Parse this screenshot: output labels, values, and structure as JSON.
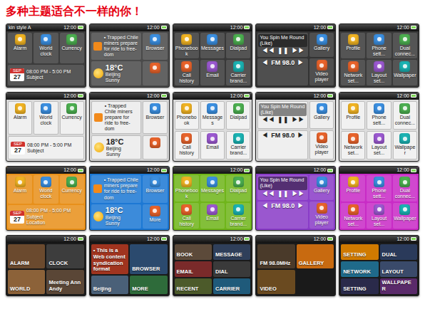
{
  "title": "多种主题适合不一样的你！",
  "rows": [
    {
      "screens": [
        {
          "kind": "home",
          "color": "#3c3c3c",
          "time": "12:00",
          "caption": "kin style A",
          "tiles": [
            {
              "kind": "app",
              "label": "Alarm"
            },
            {
              "kind": "app",
              "label": "World clock"
            },
            {
              "kind": "app",
              "label": "Currency"
            },
            {
              "kind": "event",
              "month": "SEP",
              "day": "27",
              "when": "08:00 PM - 5:00 PM",
              "subject": "Subject"
            }
          ]
        },
        {
          "kind": "feeds",
          "color": "#4a4a4a",
          "time": "12:00",
          "tiles": [
            {
              "kind": "news",
              "text": "• Trapped Chile miners prepare for ride to free-dom"
            },
            {
              "kind": "app",
              "label": "Browser"
            },
            {
              "kind": "weather",
              "temp": "18°C",
              "city": "Beijing",
              "sky": "Sunny"
            },
            {
              "kind": "app"
            }
          ]
        },
        {
          "kind": "comm",
          "color": "#383838",
          "time": "12:00",
          "tiles": [
            {
              "kind": "app",
              "label": "Phonebook"
            },
            {
              "kind": "app",
              "label": "Messages"
            },
            {
              "kind": "app",
              "label": "Dialpad"
            },
            {
              "kind": "app",
              "label": "Call history"
            },
            {
              "kind": "app",
              "label": "Email"
            },
            {
              "kind": "app",
              "label": "Carrier brand..."
            }
          ]
        },
        {
          "kind": "music",
          "color": "#333333",
          "time": "12:00",
          "tiles": [
            {
              "kind": "player",
              "song": "You Spin Me Round (Like)",
              "controls": [
                "◀◀",
                "❚❚",
                "▶▶"
              ]
            },
            {
              "kind": "app",
              "label": "Gallery"
            },
            {
              "kind": "radio",
              "station": "FM 98.0",
              "controls": [
                "◀",
                "▶"
              ]
            },
            {
              "kind": "app",
              "label": "Video player"
            }
          ]
        },
        {
          "kind": "settings",
          "color": "#3a3a3a",
          "time": "12:00",
          "tiles": [
            {
              "kind": "app",
              "label": "Profile"
            },
            {
              "kind": "app",
              "label": "Phone sett..."
            },
            {
              "kind": "app",
              "label": "Dual connec..."
            },
            {
              "kind": "app",
              "label": "Network set..."
            },
            {
              "kind": "app",
              "label": "Layout set..."
            },
            {
              "kind": "app",
              "label": "Wallpaper"
            }
          ]
        }
      ]
    },
    {
      "screens": [
        {
          "kind": "home",
          "color": "#dadada",
          "time": "12:00",
          "tiles": [
            {
              "kind": "app",
              "label": "Alarm"
            },
            {
              "kind": "app",
              "label": "World clock"
            },
            {
              "kind": "app",
              "label": "Currency"
            },
            {
              "kind": "event",
              "month": "SEP",
              "day": "27",
              "when": "08:00 PM - 5:00 PM",
              "subject": "Subject"
            }
          ]
        },
        {
          "kind": "feeds",
          "color": "#d4d4d4",
          "time": "12:00",
          "tiles": [
            {
              "kind": "news",
              "text": "• Trapped Chile miners prepare for ride to free-dom"
            },
            {
              "kind": "app",
              "label": "Browser"
            },
            {
              "kind": "weather",
              "temp": "18°C",
              "city": "Beijing",
              "sky": "Sunny"
            },
            {
              "kind": "app"
            }
          ]
        },
        {
          "kind": "comm",
          "color": "#dcdcdc",
          "time": "12:00",
          "tiles": [
            {
              "kind": "app",
              "label": "Phonebook"
            },
            {
              "kind": "app",
              "label": "Messages"
            },
            {
              "kind": "app",
              "label": "Dialpad"
            },
            {
              "kind": "app",
              "label": "Call history"
            },
            {
              "kind": "app",
              "label": "Email"
            },
            {
              "kind": "app",
              "label": "Carrier brand..."
            }
          ]
        },
        {
          "kind": "music",
          "color": "#d6d6d6",
          "time": "12:00",
          "tiles": [
            {
              "kind": "player",
              "song": "You Spin Me Round (Like)",
              "controls": [
                "◀◀",
                "❚❚",
                "▶▶"
              ]
            },
            {
              "kind": "app",
              "label": "Gallery"
            },
            {
              "kind": "radio",
              "station": "FM 98.0",
              "controls": [
                "◀",
                "▶"
              ]
            },
            {
              "kind": "app",
              "label": "Video player"
            }
          ]
        },
        {
          "kind": "settings",
          "color": "#dddddd",
          "time": "12:00",
          "tiles": [
            {
              "kind": "app",
              "label": "Profile"
            },
            {
              "kind": "app",
              "label": "Phone sett..."
            },
            {
              "kind": "app",
              "label": "Dual connec..."
            },
            {
              "kind": "app",
              "label": "Network set..."
            },
            {
              "kind": "app",
              "label": "Layout set..."
            },
            {
              "kind": "app",
              "label": "Wallpaper"
            }
          ]
        }
      ]
    },
    {
      "screens": [
        {
          "kind": "home",
          "color": "#e8901a",
          "time": "12:00",
          "tiles": [
            {
              "kind": "app",
              "label": "Alarm"
            },
            {
              "kind": "app",
              "label": "World clock"
            },
            {
              "kind": "app",
              "label": "Currency"
            },
            {
              "kind": "event",
              "month": "SEP",
              "day": "27",
              "when": "08:00 PM - 5:00 PM",
              "subject": "Subject",
              "place": "Location"
            }
          ]
        },
        {
          "kind": "feeds",
          "color": "#1c78d4",
          "time": "12:00",
          "tiles": [
            {
              "kind": "news",
              "text": "• Trapped Chile miners prepare for ride to free-dom"
            },
            {
              "kind": "app",
              "label": "Browser"
            },
            {
              "kind": "weather",
              "temp": "18°C",
              "city": "Beijing",
              "sky": "Sunny"
            },
            {
              "kind": "app",
              "label": "More"
            }
          ]
        },
        {
          "kind": "comm",
          "color": "#6fb51a",
          "time": "12:00",
          "tiles": [
            {
              "kind": "app",
              "label": "Phonebook"
            },
            {
              "kind": "app",
              "label": "Messages"
            },
            {
              "kind": "app",
              "label": "Dialpad"
            },
            {
              "kind": "app",
              "label": "Call history"
            },
            {
              "kind": "app",
              "label": "Email"
            },
            {
              "kind": "app",
              "label": "Carrier brand..."
            }
          ]
        },
        {
          "kind": "music",
          "color": "#8a3cc8",
          "time": "12:00",
          "tiles": [
            {
              "kind": "player",
              "song": "You Spin Me Round (Like)",
              "controls": [
                "◀◀",
                "❚❚",
                "▶▶"
              ]
            },
            {
              "kind": "app",
              "label": "Gallery"
            },
            {
              "kind": "radio",
              "station": "FM 98.0",
              "controls": [
                "◀",
                "▶"
              ]
            },
            {
              "kind": "app",
              "label": "Video player"
            }
          ]
        },
        {
          "kind": "settings",
          "color": "#c92bc6",
          "time": "12:00",
          "tiles": [
            {
              "kind": "app",
              "label": "Profile"
            },
            {
              "kind": "app",
              "label": "Phone sett..."
            },
            {
              "kind": "app",
              "label": "Dual connec..."
            },
            {
              "kind": "app",
              "label": "Network set..."
            },
            {
              "kind": "app",
              "label": "Layout set..."
            },
            {
              "kind": "app",
              "label": "Wallpaper"
            }
          ]
        }
      ]
    },
    {
      "screens": [
        {
          "kind": "metro",
          "color": "#1a1a1a",
          "time": "12:00",
          "tiles": [
            {
              "label": "ALARM",
              "color": "#6b4a2e"
            },
            {
              "label": "CLOCK",
              "color": "#3d3d3d"
            },
            {
              "label": "WORLD",
              "color": "#8c6239"
            },
            {
              "label": "Meeting Ann Andy",
              "color": "#5a4636"
            }
          ]
        },
        {
          "kind": "metro",
          "color": "#1a1a1a",
          "time": "12:00",
          "tiles": [
            {
              "label": "• This is a Web content syndication format",
              "color": "#a0341f"
            },
            {
              "label": "BROWSER",
              "color": "#2b4a6e"
            },
            {
              "label": "Beijing",
              "color": "#4a6078"
            },
            {
              "label": "MORE",
              "color": "#2e6b3a"
            }
          ]
        },
        {
          "kind": "metro",
          "color": "#1a1a1a",
          "time": "12:00",
          "tiles": [
            {
              "label": "BOOK",
              "color": "#5c4a3a"
            },
            {
              "label": "MESSAGE",
              "color": "#2f3f5a"
            },
            {
              "label": "EMAIL",
              "color": "#7a2a2a"
            },
            {
              "label": "DIAL",
              "color": "#3a3a3a"
            },
            {
              "label": "RECENT",
              "color": "#4c5a2a"
            },
            {
              "label": "CARRIER",
              "color": "#1f5a7a"
            }
          ]
        },
        {
          "kind": "metro",
          "color": "#1a1a1a",
          "time": "12:00",
          "tiles": [
            {
              "label": "FM 98.0MHz",
              "color": "#4a3a2a"
            },
            {
              "label": "GALLERY",
              "color": "#c86a10"
            },
            {
              "label": "VIDEO",
              "color": "#6a4a20"
            }
          ]
        },
        {
          "kind": "metro",
          "color": "#1a1a1a",
          "time": "12:00",
          "tiles": [
            {
              "label": "SETTING",
              "color": "#d07a00"
            },
            {
              "label": "DUAL",
              "color": "#2a3a5a"
            },
            {
              "label": "NETWORK",
              "color": "#1f6a8a"
            },
            {
              "label": "LAYOUT",
              "color": "#3a4a6a"
            },
            {
              "label": "SETTING",
              "color": "#2a2a4a"
            },
            {
              "label": "WALLPAPER",
              "color": "#5a2a6a"
            }
          ]
        }
      ]
    }
  ]
}
